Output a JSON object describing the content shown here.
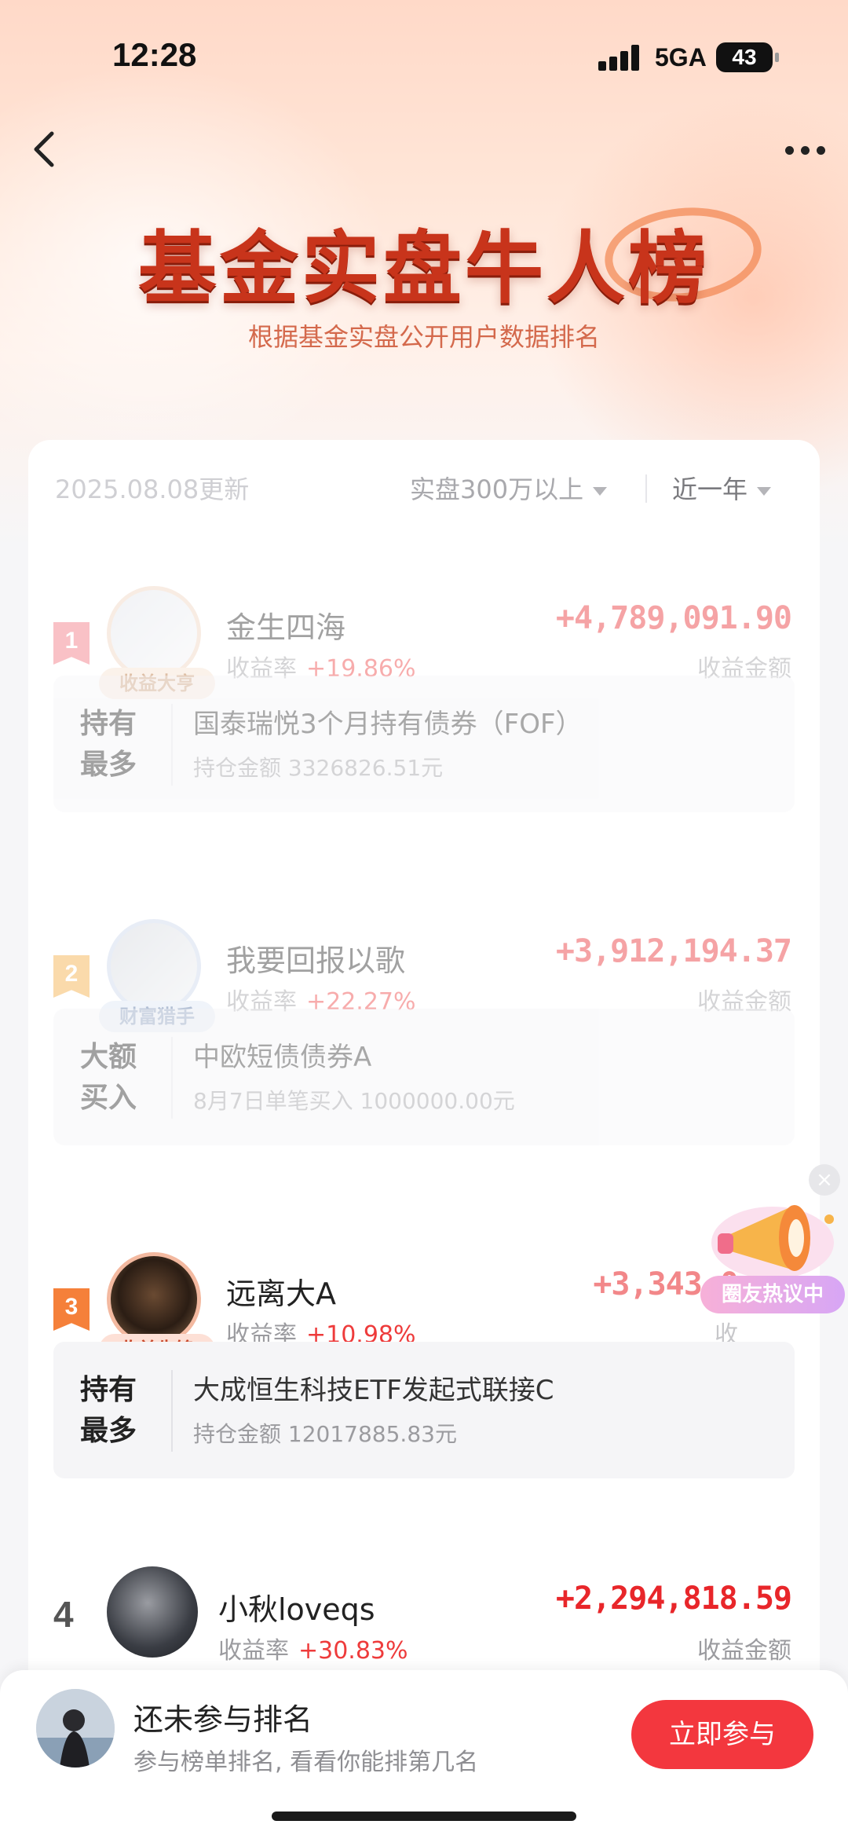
{
  "status_bar": {
    "time": "12:28",
    "network": "5GA",
    "battery": "43"
  },
  "header": {
    "title": "基金实盘牛人榜",
    "subtitle": "根据基金实盘公开用户数据排名"
  },
  "filters": {
    "update_date": "2025.08.08更新",
    "amount_filter": "实盘300万以上",
    "period_filter": "近一年"
  },
  "entries": [
    {
      "rank": "1",
      "name": "金生四海",
      "badge": "收益大亨",
      "rate_label": "收益率",
      "rate": "+19.86%",
      "amount": "+4,789,091.90",
      "amount_label": "收益金额",
      "hold_tag_1": "持有",
      "hold_tag_2": "最多",
      "fund": "国泰瑞悦3个月持有债券（FOF）",
      "detail": "持仓金额 3326826.51元"
    },
    {
      "rank": "2",
      "name": "我要回报以歌",
      "badge": "财富猎手",
      "rate_label": "收益率",
      "rate": "+22.27%",
      "amount": "+3,912,194.37",
      "amount_label": "收益金额",
      "hold_tag_1": "大额",
      "hold_tag_2": "买入",
      "fund": "中欧短债债券A",
      "detail": "8月7日单笔买入 1000000.00元"
    },
    {
      "rank": "3",
      "name": "远离大A",
      "badge": "收益先锋",
      "rate_label": "收益率",
      "rate": "+10.98%",
      "amount": "+3,343,0",
      "amount_label": "收",
      "hold_tag_1": "持有",
      "hold_tag_2": "最多",
      "fund": "大成恒生科技ETF发起式联接C",
      "detail": "持仓金额 12017885.83元"
    },
    {
      "rank": "4",
      "name": "小秋loveqs",
      "rate_label": "收益率",
      "rate": "+30.83%",
      "amount": "+2,294,818.59",
      "amount_label": "收益金额"
    }
  ],
  "promo": {
    "label": "圈友热议中"
  },
  "bottom_bar": {
    "title": "还未参与排名",
    "subtitle": "参与榜单排名, 看看你能排第几名",
    "button": "立即参与"
  },
  "colors": {
    "accent": "#e8262a",
    "title": "#c8341b",
    "rank1": "#f26d78",
    "rank2": "#f4a93a",
    "rank3": "#f5803a"
  },
  "icons": [
    "back-arrow-icon",
    "more-icon",
    "dropdown-caret-icon",
    "megaphone-icon",
    "close-icon"
  ]
}
